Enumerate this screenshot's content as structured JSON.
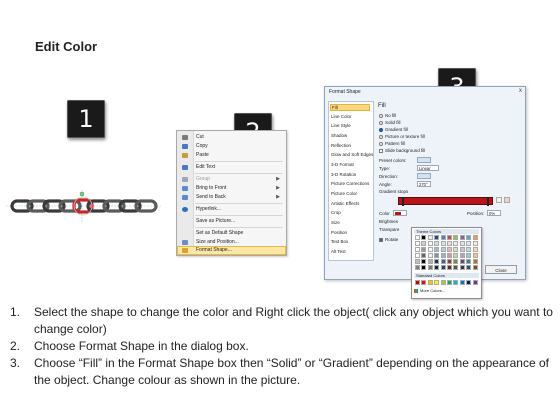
{
  "title": "Edit Color",
  "step_badges": [
    "1",
    "2",
    "3"
  ],
  "context_menu": {
    "items": [
      {
        "label": "Cut",
        "icon": "scissors-icon",
        "color": "#7a7a7a",
        "submenu": false
      },
      {
        "label": "Copy",
        "icon": "copy-icon",
        "color": "#4a78c2",
        "submenu": false
      },
      {
        "label": "Paste",
        "icon": "paste-icon",
        "color": "#c99a3b",
        "submenu": false
      },
      {
        "label": "Edit Text",
        "icon": "edit-text-icon",
        "color": "#4a78c2",
        "submenu": false
      },
      {
        "label": "Group",
        "icon": "group-icon",
        "color": "#9aa7b8",
        "submenu": true
      },
      {
        "label": "Bring to Front",
        "icon": "bring-front-icon",
        "color": "#5a8bd1",
        "submenu": true
      },
      {
        "label": "Send to Back",
        "icon": "send-back-icon",
        "color": "#5a8bd1",
        "submenu": true
      },
      {
        "label": "Hyperlink...",
        "icon": "hyperlink-icon",
        "color": "#2e6bc6",
        "submenu": false
      },
      {
        "label": "Save as Picture...",
        "icon": "",
        "color": "",
        "submenu": false
      },
      {
        "label": "Set as Default Shape",
        "icon": "",
        "color": "",
        "submenu": false
      },
      {
        "label": "Size and Position...",
        "icon": "size-position-icon",
        "color": "#6b8fc4",
        "submenu": false
      },
      {
        "label": "Format Shape...",
        "icon": "format-shape-icon",
        "color": "#e0a030",
        "submenu": false,
        "highlighted": true
      }
    ]
  },
  "dialog": {
    "title": "Format Shape",
    "close": "x",
    "nav": [
      "Fill",
      "Line Color",
      "Line Style",
      "Shadow",
      "Reflection",
      "Glow and Soft Edges",
      "3-D Format",
      "3-D Rotation",
      "Picture Corrections",
      "Picture Color",
      "Artistic Effects",
      "Crop",
      "Size",
      "Position",
      "Text Box",
      "Alt Text"
    ],
    "nav_selected": "Fill",
    "panel_title": "Fill",
    "fill_options": [
      {
        "label": "No fill",
        "type": "radio",
        "checked": false
      },
      {
        "label": "Solid fill",
        "type": "radio",
        "checked": false
      },
      {
        "label": "Gradient fill",
        "type": "radio",
        "checked": true
      },
      {
        "label": "Picture or texture fill",
        "type": "radio",
        "checked": false
      },
      {
        "label": "Pattern fill",
        "type": "radio",
        "checked": false
      },
      {
        "label": "Slide background fill",
        "type": "checkbox",
        "checked": false
      }
    ],
    "preset_colors_label": "Preset colors:",
    "type_label": "Type:",
    "type_value": "Linear",
    "direction_label": "Direction:",
    "angle_label": "Angle:",
    "angle_value": "270°",
    "gradient_stops_label": "Gradient stops",
    "color_label": "Color",
    "position_label": "Position:",
    "position_value": "0%",
    "brightness_label": "Brightnes",
    "transparency_label": "Transpare",
    "rotate_label": "Rotate",
    "close_button": "Close",
    "gradient_color": "#b8151b"
  },
  "color_popup": {
    "theme_header": "Theme Colors",
    "standard_header": "Standard Colors",
    "more_colors": "More Colors...",
    "theme_columns": [
      "#ffffff",
      "#000000",
      "#eeece1",
      "#1f497d",
      "#4f81bd",
      "#c0504d",
      "#9bbb59",
      "#8064a2",
      "#4bacc6",
      "#f79646"
    ],
    "standard": [
      "#c00000",
      "#ff0000",
      "#ffc000",
      "#ffff00",
      "#92d050",
      "#00b050",
      "#00b0f0",
      "#0070c0",
      "#002060",
      "#7030a0"
    ]
  },
  "instructions": [
    {
      "num": "1.",
      "text": "Select the shape to change the color and Right click the object( click any object which you want to change color)"
    },
    {
      "num": "2.",
      "text": "Choose Format Shape in the dialog box."
    },
    {
      "num": "3.",
      "text": "Choose “Fill” in the Format Shape box then “Solid” or “Gradient” depending on the appearance of the object. Change colour as shown in the picture."
    }
  ]
}
